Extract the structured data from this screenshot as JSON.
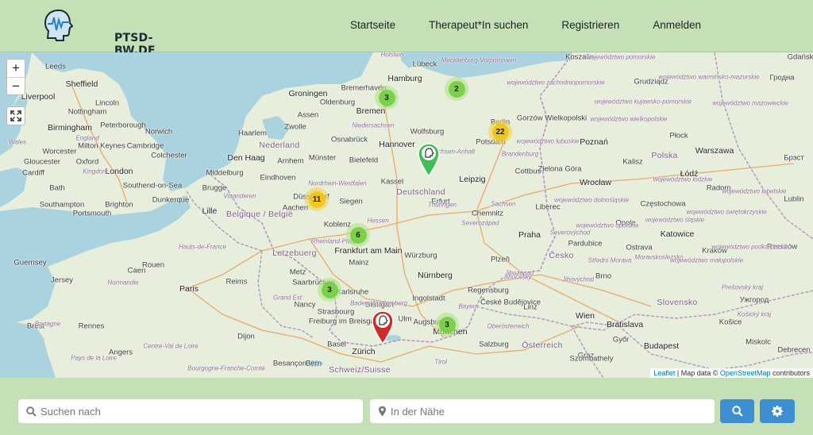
{
  "header": {
    "logo_text": "PTSD-BW.DE",
    "nav": [
      "Startseite",
      "Therapeut*In suchen",
      "Registrieren",
      "Anmelden"
    ]
  },
  "map": {
    "zoom_in": "+",
    "zoom_out": "−",
    "clusters": [
      {
        "count": "3",
        "color": "green"
      },
      {
        "count": "2",
        "color": "green"
      },
      {
        "count": "22",
        "color": "yellow"
      },
      {
        "count": "11",
        "color": "yellow"
      },
      {
        "count": "6",
        "color": "green"
      },
      {
        "count": "3",
        "color": "green"
      },
      {
        "count": "3",
        "color": "green"
      }
    ],
    "pins": [
      {
        "color": "#3fbf5a"
      },
      {
        "color": "#cf2b2b"
      }
    ],
    "attribution": {
      "leaflet": "Leaflet",
      "separator": " | Map data © ",
      "osm": "OpenStreetMap",
      "suffix": " contributors"
    },
    "places": [
      "Leeds",
      "Sheffield",
      "Liverpool",
      "Lincoln",
      "Peterborough",
      "Nottingham",
      "Birmingham",
      "Norwich",
      "Milton Keynes",
      "Cambridge",
      "Colchester",
      "Worcester",
      "Gloucester",
      "Oxford",
      "London",
      "Southend-on-Sea",
      "Cardiff",
      "Bath",
      "Southampton",
      "Portsmouth",
      "Brighton",
      "Dunkerque",
      "Guernsey",
      "Jersey",
      "Rennes",
      "Angers",
      "Caen",
      "Rouen",
      "Reims",
      "Paris",
      "Lille",
      "Brugge",
      "Middelburg",
      "Den Haag",
      "Haarlem",
      "Zwolle",
      "Groningen",
      "Oldenburg",
      "Bremerhaven",
      "Bremen",
      "Assen",
      "Nederland",
      "Arnhem",
      "Eindhoven",
      "Münster",
      "Osnabrück",
      "Bielefeld",
      "Hannover",
      "Wolfsburg",
      "Hamburg",
      "Lübeck",
      "Holstein",
      "Koszalin",
      "Gdańsk",
      "Grudziądz",
      "Gorzów Wielkopolski",
      "Poznań",
      "Płock",
      "Polska",
      "Warszawa",
      "Radom",
      "Kalisz",
      "Łódź",
      "Częstochowa",
      "Katowice",
      "Opole",
      "Ostrava",
      "Wrocław",
      "Liberec",
      "Praha",
      "Česko",
      "Pardubice",
      "Plzeň",
      "Brno",
      "Zielona Góra",
      "Cottbus",
      "Leipzig",
      "Potsdam",
      "Berlin",
      "Deutschland",
      "Kassel",
      "Erfurt",
      "Chemnitz",
      "Sachsen",
      "Siegen",
      "Düsseldorf",
      "Aachen",
      "Belgique / België",
      "Koblenz",
      "Frankfurt am Main",
      "Mainz",
      "Würzburg",
      "Nürnberg",
      "Regensburg",
      "Ingolstadt",
      "Augsburg",
      "München",
      "Ulm",
      "Stuttgart",
      "Karlsruhe",
      "Saarbrücken",
      "Letzebuerg",
      "Metz",
      "Nancy",
      "Strasbourg",
      "Freiburg im Breisgau",
      "Basel",
      "Zürich",
      "Bern",
      "Besançon",
      "Dijon",
      "Schweiz/Suisse",
      "Bratislava",
      "Wien",
      "Linz",
      "Salzburg",
      "Österreich",
      "Graz",
      "Budapest",
      "Szombathely",
      "Győr",
      "Slovensko",
      "Košice",
      "Miskolc",
      "Debrecen",
      "Ужгород",
      "Brest",
      "Гродна",
      "Брэст",
      "Lublin",
      "Kraków",
      "Rzeszów",
      "České Budějovice",
      "Jihočeský",
      "Bretagne",
      "Normandie",
      "Centre-Val de Loire",
      "Pays de la Loire",
      "Hauts-de-France",
      "Grand Est",
      "Bourgogne-Franche-Comté",
      "Vlaanderen",
      "Nordrhein-Westfalen",
      "Niedersachsen",
      "Hessen",
      "Thüringen",
      "Baden-Württemberg",
      "Bayern",
      "Sachsen-Anhalt",
      "Mecklenburg-Vorpommern",
      "Brandenburg",
      "Rheinland-Pfalz",
      "Oberösterreich",
      "Tirol",
      "Severozápad",
      "Severovýchod",
      "Jihovýchod",
      "Střední Morava",
      "Jihozápad",
      "Moravskoslezsko",
      "województwo pomorskie",
      "województwo zachodniopomorskie",
      "województwo kujawsko-pomorskie",
      "województwo warmińsko-mazurskie",
      "województwo wielkopolskie",
      "województwo lubuskie",
      "województwo dolnośląskie",
      "województwo opolskie",
      "województwo śląskie",
      "województwo łódzkie",
      "województwo mazowieckie",
      "województwo lubelskie",
      "województwo świętokrzyskie",
      "województwo małopolskie",
      "województwo podkarpackie",
      "Prešovský kraj",
      "Košický kraj",
      "Wales",
      "Kingdom",
      "England",
      "Paris"
    ]
  },
  "search": {
    "query_placeholder": "Suchen nach",
    "location_placeholder": "In der Nähe"
  },
  "colors": {
    "header_bg": "#c5dfb6",
    "button_bg": "#3d8fd1",
    "water": "#aad3df",
    "land": "#e7eedb"
  }
}
